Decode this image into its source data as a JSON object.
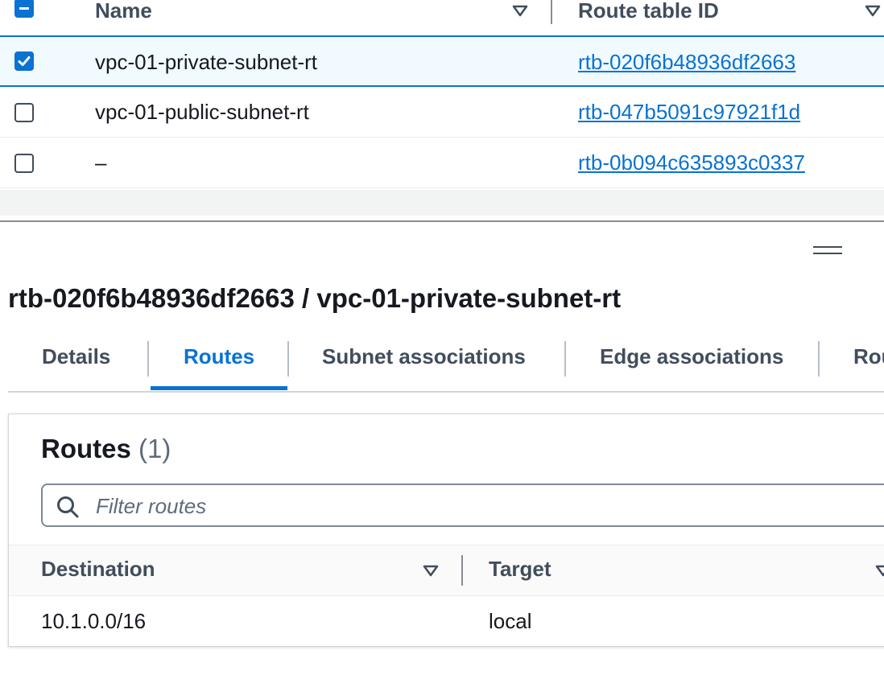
{
  "top_table": {
    "columns": [
      {
        "label": "Name"
      },
      {
        "label": "Route table ID"
      }
    ],
    "rows": [
      {
        "name": "vpc-01-private-subnet-rt",
        "id": "rtb-020f6b48936df2663",
        "selected": true
      },
      {
        "name": "vpc-01-public-subnet-rt",
        "id": "rtb-047b5091c97921f1d",
        "selected": false
      },
      {
        "name": "–",
        "id": "rtb-0b094c635893c0337",
        "selected": false
      }
    ]
  },
  "details": {
    "title": "rtb-020f6b48936df2663 / vpc-01-private-subnet-rt",
    "tabs": [
      {
        "label": "Details"
      },
      {
        "label": "Routes"
      },
      {
        "label": "Subnet associations"
      },
      {
        "label": "Edge associations"
      },
      {
        "label": "Route propagation"
      }
    ],
    "active_tab": "Routes"
  },
  "routes": {
    "heading": "Routes",
    "count": "(1)",
    "filter_placeholder": "Filter routes",
    "columns": [
      {
        "label": "Destination"
      },
      {
        "label": "Target"
      }
    ],
    "rows": [
      {
        "destination": "10.1.0.0/16",
        "target": "local"
      }
    ]
  },
  "colors": {
    "accent": "#0972d3",
    "text": "#16191f",
    "muted": "#414d5c"
  }
}
